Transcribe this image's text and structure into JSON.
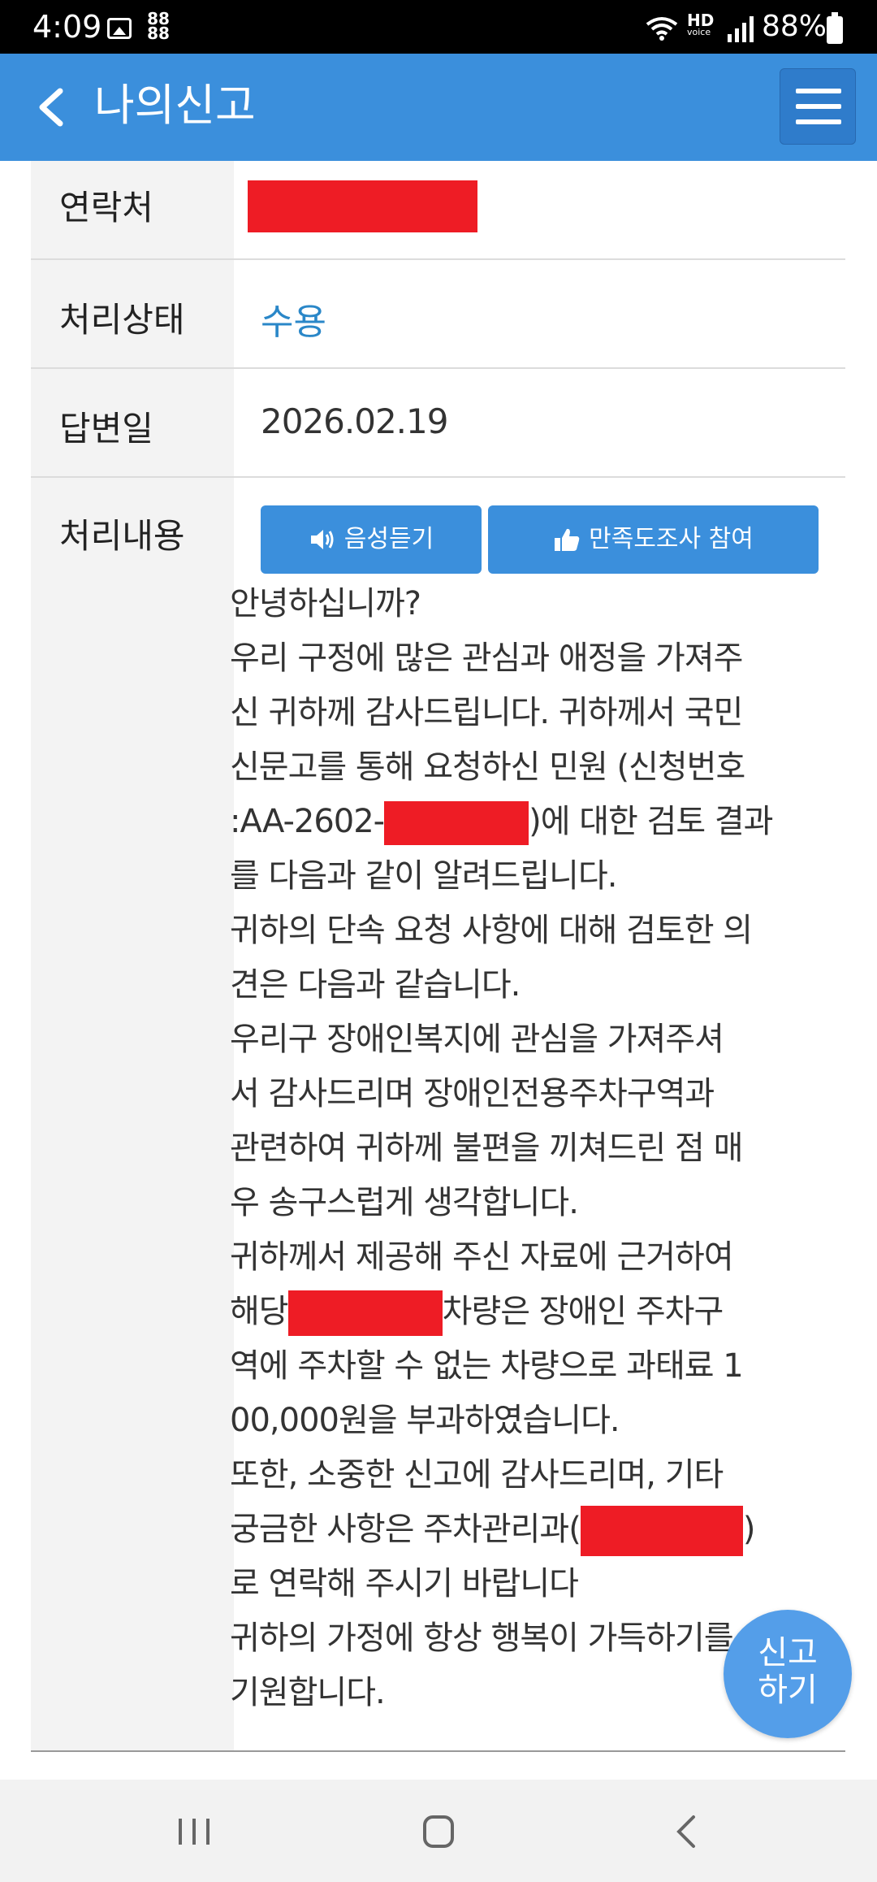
{
  "status_bar": {
    "time": "4:09",
    "hd_label": "HD",
    "voice_label": "voice",
    "battery": "88%"
  },
  "header": {
    "title": "나의신고"
  },
  "details": {
    "contact_label": "연락처",
    "status_label": "처리상태",
    "status_value": "수용",
    "status_color": "#2a87c8",
    "date_label": "답변일",
    "date_value": "2026.02.19",
    "content_label": "처리내용"
  },
  "buttons": {
    "voice": "음성듣기",
    "survey": "만족도조사 참여"
  },
  "content": {
    "lines": [
      "안녕하십니까?",
      "우리 구정에 많은 관심과 애정을 가져주",
      "신 귀하께 감사드립니다. 귀하께서 국민",
      "신문고를 통해 요청하신 민원 (신청번호",
      ":AA-2602-",
      ")에 대한 검토 결과",
      "를 다음과 같이 알려드립니다.",
      "귀하의 단속 요청 사항에 대해 검토한 의",
      "견은 다음과 같습니다.",
      "우리구 장애인복지에 관심을 가져주셔",
      "서 감사드리며 장애인전용주차구역과",
      "관련하여 귀하께 불편을 끼쳐드린 점 매",
      "우 송구스럽게 생각합니다.",
      "귀하께서 제공해 주신 자료에 근거하여",
      "해당",
      "차량은 장애인 주차구",
      "역에 주차할 수 없는 차량으로 과태료 1",
      "00,000원을 부과하였습니다.",
      "또한, 소중한 신고에 감사드리며, 기타",
      "궁금한 사항은 주차관리과(",
      ")",
      "로 연락해 주시기 바랍니다",
      "귀하의 가정에 항상 행복이 가득하기를",
      "기원합니다."
    ]
  },
  "fab": {
    "line1": "신고",
    "line2": "하기"
  },
  "colors": {
    "header_bg": "#3b8fdc",
    "redaction": "#ee1c25"
  }
}
